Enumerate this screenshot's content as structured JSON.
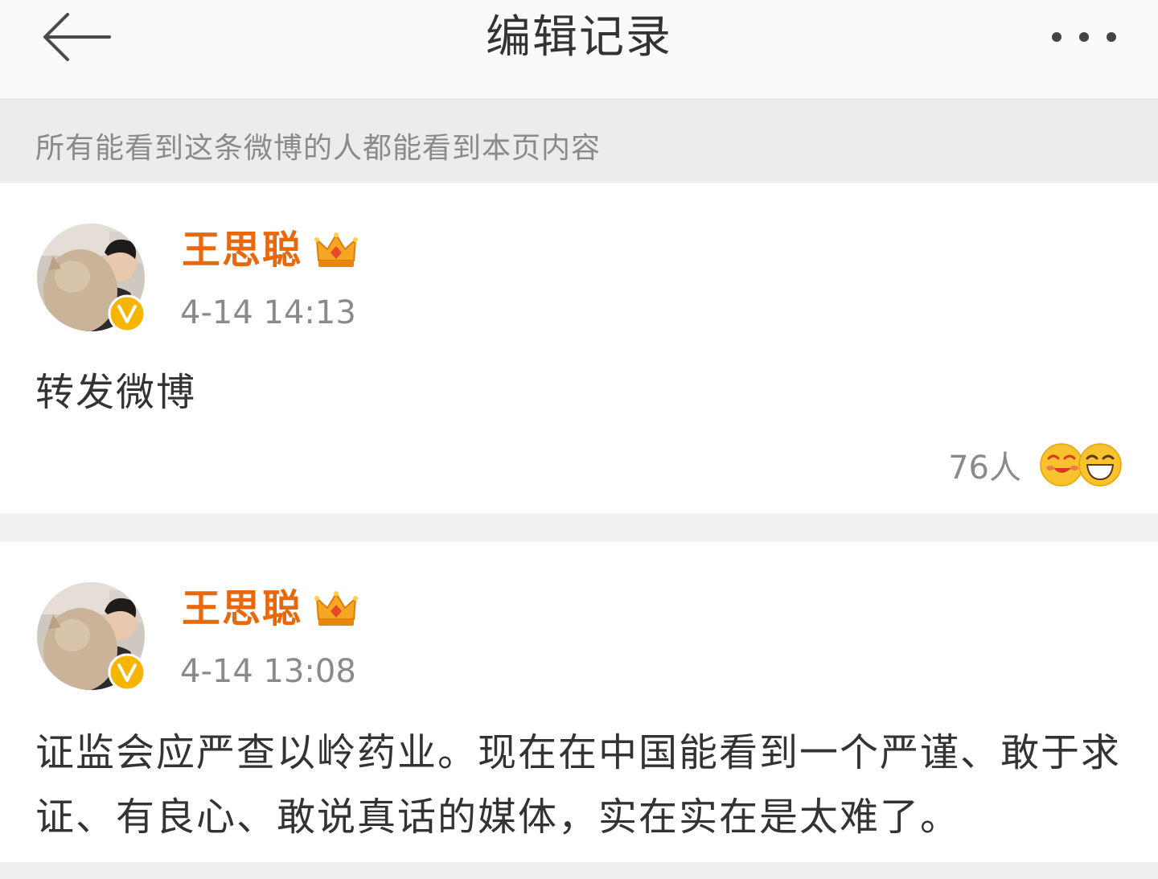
{
  "header": {
    "title": "编辑记录",
    "back_icon": "arrow-left-icon",
    "more_icon": "ellipsis-icon"
  },
  "notice": {
    "text": "所有能看到这条微博的人都能看到本页内容"
  },
  "posts": [
    {
      "username": "王思聪",
      "badge_icon": "crown-icon",
      "verified_icon": "verified-v-icon",
      "time": "4-14 14:13",
      "content": "转发微博",
      "reaction_count": "76人",
      "reaction_icons": [
        "dizzy-kiss-emoji-icon",
        "laughing-emoji-icon"
      ]
    },
    {
      "username": "王思聪",
      "badge_icon": "crown-icon",
      "verified_icon": "verified-v-icon",
      "time": "4-14 13:08",
      "content": "证监会应严查以岭药业。现在在中国能看到一个严谨、敢于求证、有良心、敢说真话的媒体，实在实在是太难了。"
    }
  ],
  "colors": {
    "username": "#e8680b",
    "verified_badge": "#f7b500",
    "page_bg": "#f1f1f1",
    "card_bg": "#ffffff",
    "secondary_text": "#8a8a8a",
    "primary_text": "#333333"
  }
}
